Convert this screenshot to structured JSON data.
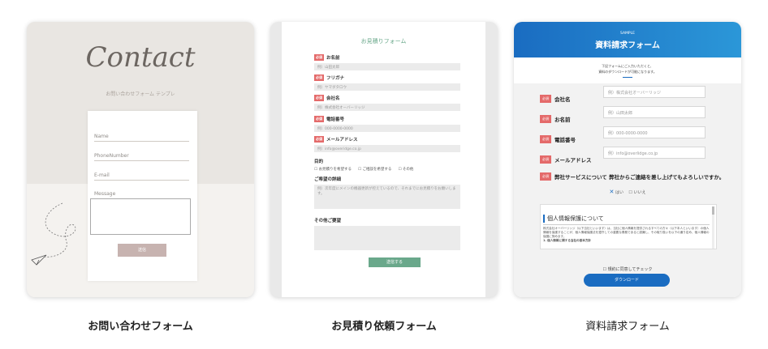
{
  "cards": [
    {
      "caption": "お問い合わせフォーム",
      "logo": "Contact",
      "logo_sub": "お問い合わせフォーム テンプレ",
      "fields": [
        "Name",
        "PhoneNumber",
        "E-mail",
        "Message"
      ],
      "submit": "送信"
    },
    {
      "caption": "お見積り依頼フォーム",
      "title": "お見積りフォーム",
      "required_badge": "必須",
      "fields": [
        {
          "label": "お名前",
          "placeholder": "例）山田太郎"
        },
        {
          "label": "フリガナ",
          "placeholder": "例）ヤマダタロウ"
        },
        {
          "label": "会社名",
          "placeholder": "例）株式会社オーバーリッジ"
        },
        {
          "label": "電話番号",
          "placeholder": "例）000-0000-0000"
        },
        {
          "label": "メールアドレス",
          "placeholder": "例）info@overidge.co.jp"
        }
      ],
      "purpose_label": "目的",
      "purpose_options": [
        "お見積りを希望する",
        "ご相談を希望する",
        "その他"
      ],
      "detail_label": "ご希望の詳細",
      "detail_placeholder": "例）次年度にメインの機器更新が控えているので、それまでにお見積りをお願いします。",
      "other_label": "その他ご要望",
      "submit": "送信する"
    },
    {
      "caption": "資料請求フォーム",
      "sample": "SAMPLE",
      "title": "資料請求フォーム",
      "intro_1": "下記フォームにご入力いただくと、",
      "intro_2": "資料のダウンロードが可能になります。",
      "required_badge": "必須",
      "fields": [
        {
          "label": "会社名",
          "placeholder": "例）株式会社オーバーリッジ"
        },
        {
          "label": "お名前",
          "placeholder": "例）山田太郎"
        },
        {
          "label": "電話番号",
          "placeholder": "例）000-0000-0000"
        },
        {
          "label": "メールアドレス",
          "placeholder": "例）info@overlidge.co.jp"
        }
      ],
      "long_question": "弊社サービスについて 弊社からご連絡を差し上げてもよろしいですか。",
      "radio_yes": "はい",
      "radio_no": "いいえ",
      "privacy_title": "個人情報保護について",
      "privacy_text": "株式会社オーバーリッジ（以下当社といいます）は、当社に個人情報を提供されるすべての方々（以下本人といいます）の個人情報を保護することが、個人情報保護法を遵守しての重要な責務であると認識し、その取り扱いを以下の通り定め、個人情報の保護に努めます。",
      "privacy_section": "1. 個人情報に関する当社の基本方針",
      "agree": "規約に同意してチェック",
      "download": "ダウンロード"
    }
  ]
}
